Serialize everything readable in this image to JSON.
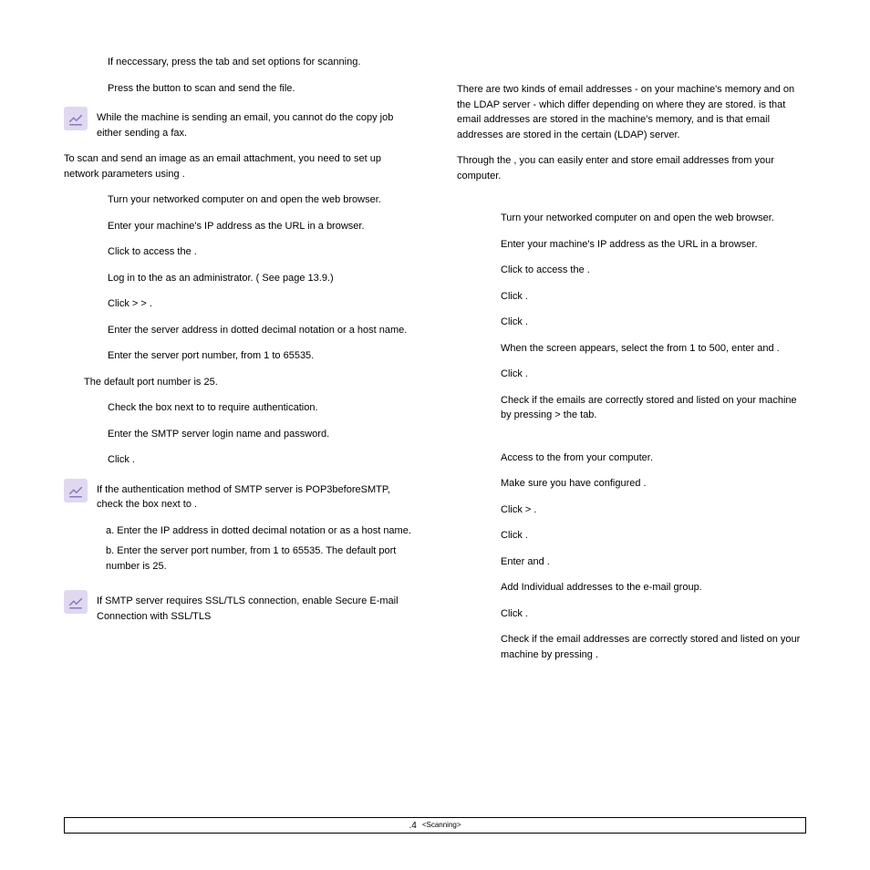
{
  "left": {
    "top_steps": [
      "If neccessary, press the            tab and set options for scanning.",
      "Press the          button to scan and send the file."
    ],
    "note1": "While the machine is sending an email, you cannot do the copy job either sending a fax.",
    "intro": "To scan and send an image as an email attachment, you need to set up network parameters using                                          .",
    "steps": [
      "Turn your networked computer on and open the web browser.",
      "Enter your machine's IP address as the URL in a browser.",
      "Click         to access the                                                 .",
      "Log in to the                                                  as an administrator. ( See  page 13.9.)",
      "Click                       >                                    >                                            .",
      "Enter the server address in dotted decimal notation or a host name.",
      "Enter the server port number, from 1 to 65535.",
      "The default port number is 25.",
      "Check the box next to                                                               to require authentication.",
      "Enter the SMTP server login name and password.",
      "Click            ."
    ],
    "note2_p1": "If the authentication method of SMTP server is POP3beforeSMTP, check the box next to                                                .",
    "note2_pa": "a. Enter the IP address in dotted decimal notation or as a host name.",
    "note2_pb": "b. Enter the server port number, from 1 to 65535. The default port number is 25.",
    "note3": "If SMTP server requires SSL/TLS connection, enable Secure E-mail Connection with SSL/TLS"
  },
  "right": {
    "intro1": "There are two kinds of email addresses -             on your machine's  memory and              on the LDAP server - which differ depending on where they are stored.             is that email addresses are stored in the machine's memory, and               is that email addresses are stored in the certain (LDAP) server.",
    "intro2": "Through the                                                , you can easily enter and store email addresses from your computer.",
    "block1_steps": [
      "Turn your networked computer on and open the web browser.",
      "Enter your machine's IP address as the URL in a browser.",
      "Click         to access the                                                                .",
      "Click                          .",
      "Click           .",
      "When the                       screen appears, select the                    from 1 to 500, enter                 and                           .",
      "Click            .",
      "Check if the emails are correctly stored and listed on your machine by pressing                > the                 tab."
    ],
    "block2_steps": [
      "Access to the                                                     from your computer.",
      "Make sure you have configured                                                      .",
      "Click                            >                        .",
      "Click                      .",
      "Enter                       and                          .",
      "Add Individual addresses to the e-mail group.",
      "Click            .",
      "Check if the email addresses are correctly stored and listed on your machine by pressing                ."
    ]
  },
  "footer": {
    "page": ".4",
    "section": "<Scanning>"
  }
}
